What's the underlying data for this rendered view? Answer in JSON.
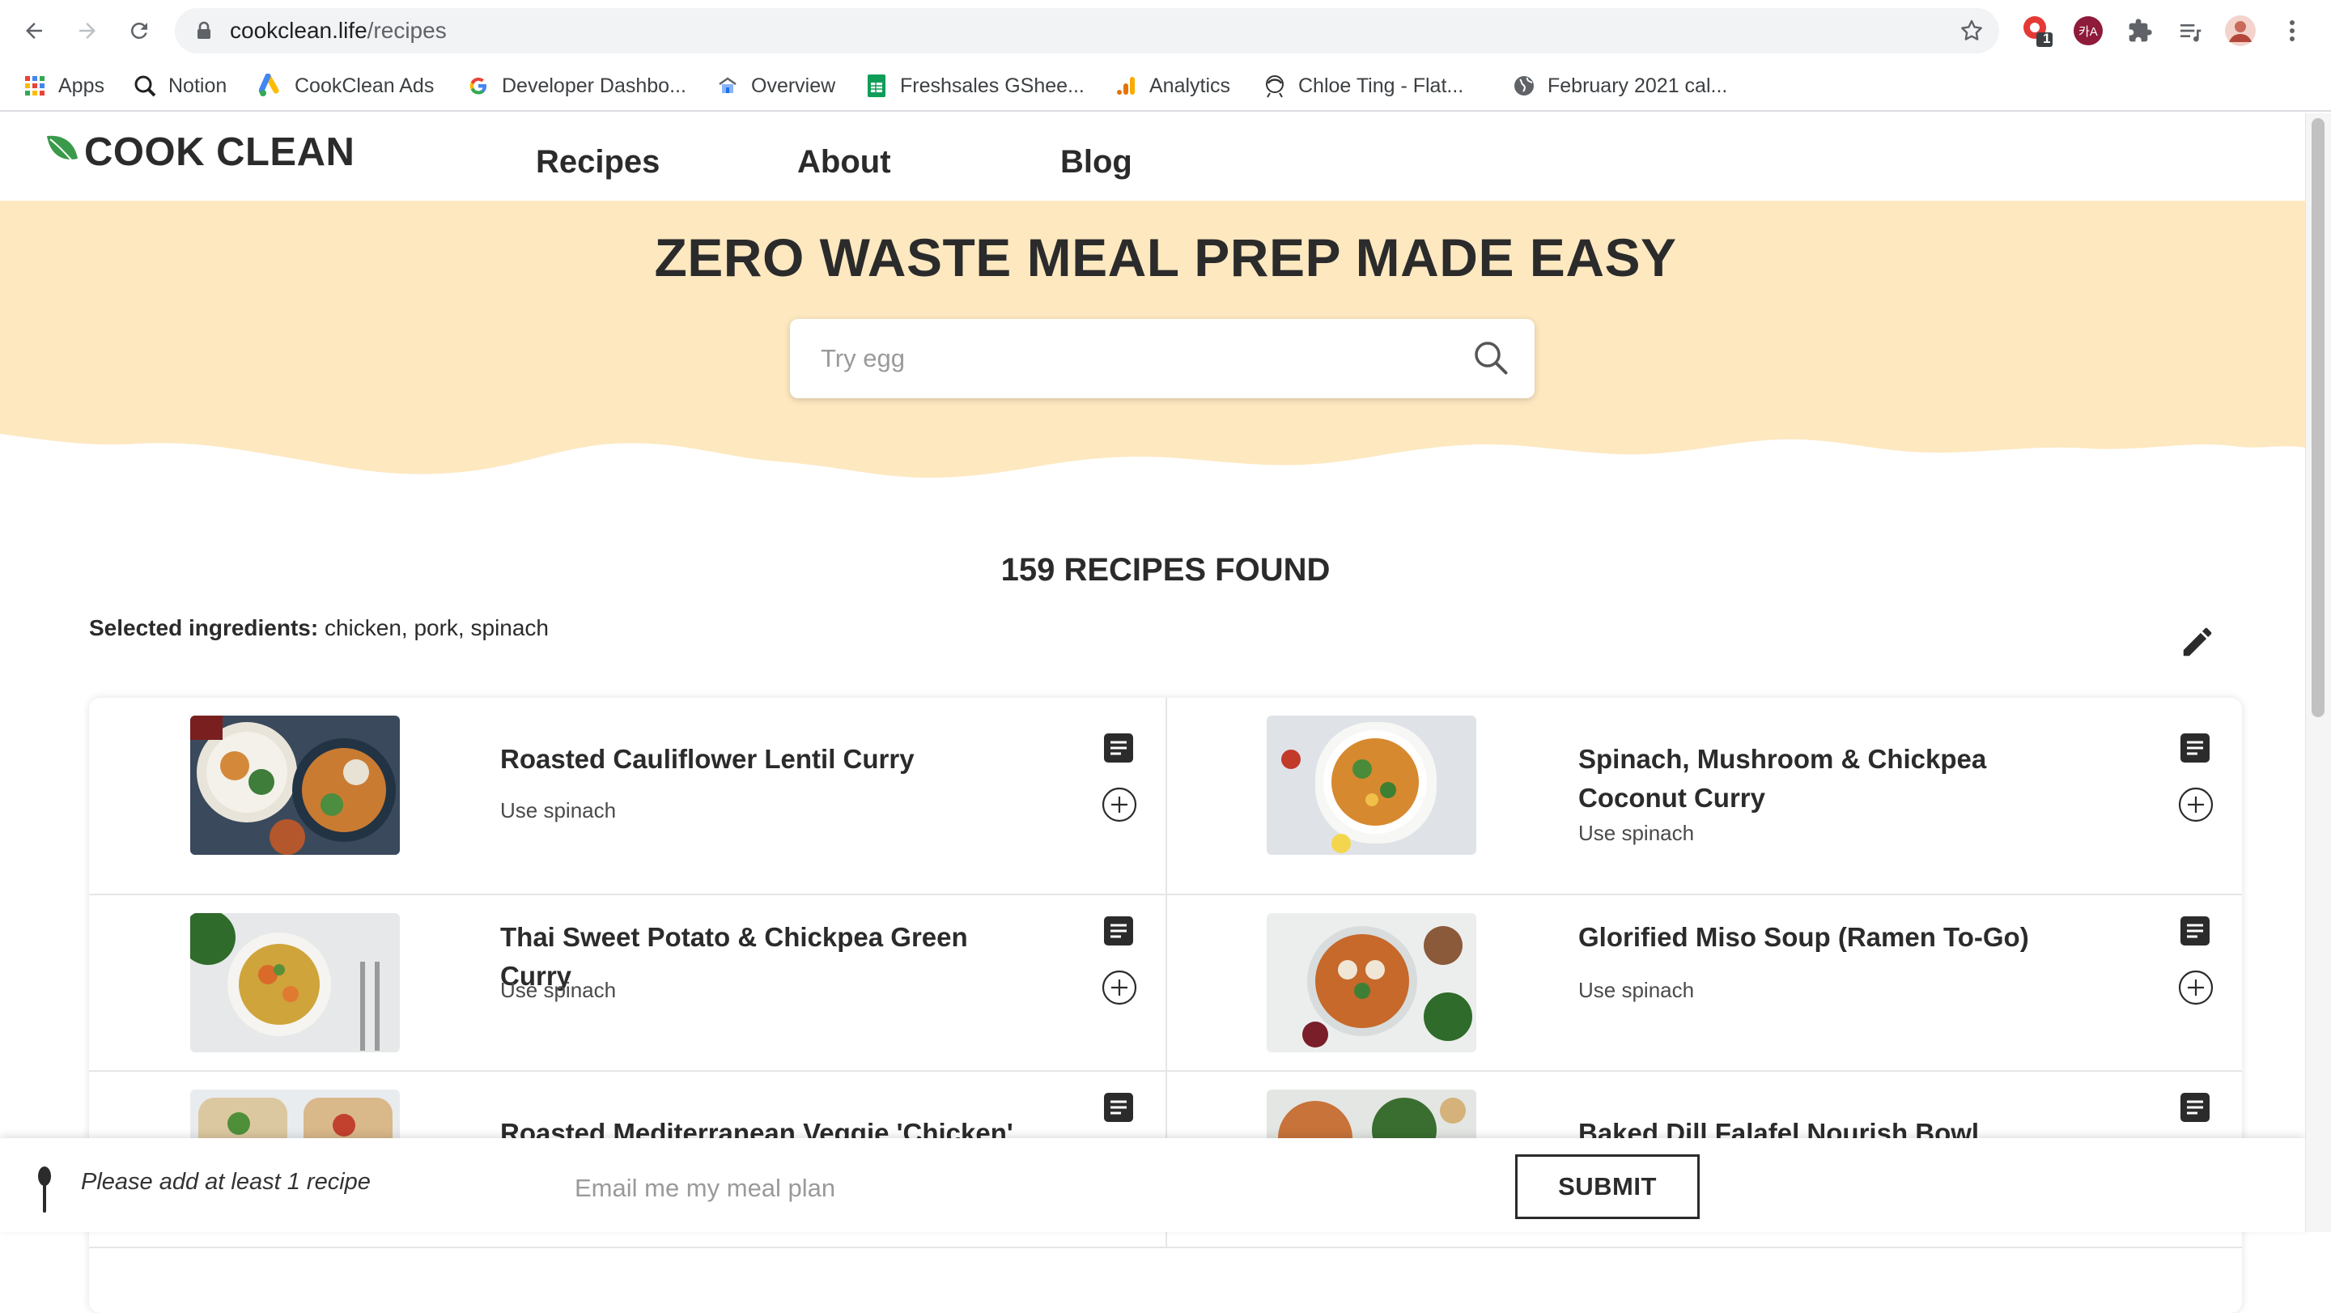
{
  "browser": {
    "url_domain": "cookclean.life",
    "url_path": "/recipes",
    "extension_badge": "1",
    "profile_ext_label": "카A",
    "bookmarks": [
      {
        "label": "Apps",
        "icon": "apps-grid-icon"
      },
      {
        "label": "Notion",
        "icon": "notion-icon"
      },
      {
        "label": "CookClean Ads",
        "icon": "google-ads-icon"
      },
      {
        "label": "Developer Dashbo...",
        "icon": "google-g-icon"
      },
      {
        "label": "Overview",
        "icon": "overview-icon"
      },
      {
        "label": "Freshsales GShee...",
        "icon": "google-sheets-icon"
      },
      {
        "label": "Analytics",
        "icon": "analytics-icon"
      },
      {
        "label": "Chloe Ting - Flat...",
        "icon": "chloe-ting-icon"
      },
      {
        "label": "February 2021 cal...",
        "icon": "globe-icon"
      }
    ]
  },
  "site": {
    "logo_text": "COOK CLEAN",
    "nav": [
      "Recipes",
      "About",
      "Blog"
    ],
    "colors": {
      "hero_bg": "#fde8c0",
      "leaf_green": "#3a9a4a",
      "text_dark": "#2b2b2b"
    }
  },
  "hero": {
    "title": "ZERO WASTE MEAL PREP MADE EASY",
    "search_placeholder": "Try egg"
  },
  "results": {
    "count_text": "159 RECIPES FOUND",
    "selected_label": "Selected ingredients:",
    "selected_value": "chicken, pork, spinach",
    "recipes": [
      {
        "title": "Roasted Cauliflower Lentil Curry",
        "sub": "Use spinach"
      },
      {
        "title": "Spinach, Mushroom & Chickpea Coconut Curry",
        "sub": "Use spinach"
      },
      {
        "title": "Thai Sweet Potato & Chickpea Green Curry",
        "sub": "Use spinach"
      },
      {
        "title": "Glorified Miso Soup (Ramen To-Go)",
        "sub": "Use spinach"
      },
      {
        "title": "Roasted Mediterranean Veggie 'Chicken'",
        "sub": ""
      },
      {
        "title": "Baked Dill Falafel Nourish Bowl",
        "sub": ""
      }
    ]
  },
  "bottom_bar": {
    "hint": "Please add at least 1 recipe",
    "email_placeholder": "Email me my meal plan",
    "submit_label": "SUBMIT"
  }
}
